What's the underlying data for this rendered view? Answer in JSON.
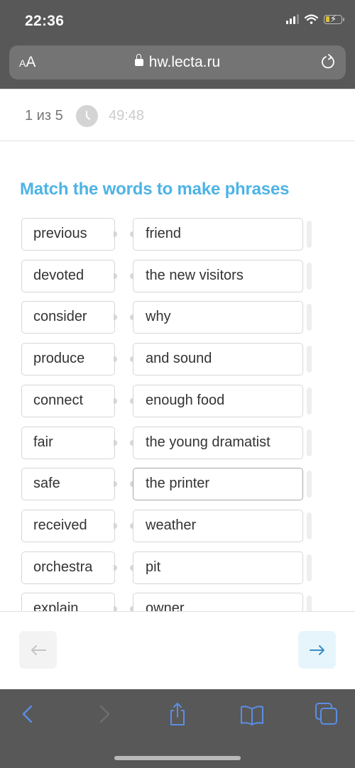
{
  "status_bar": {
    "time": "22:36",
    "icons": [
      "cellular-signal-icon",
      "wifi-icon",
      "battery-charging-icon"
    ]
  },
  "browser": {
    "text_size_label_small": "A",
    "text_size_label_large": "A",
    "url": "hw.lecta.ru",
    "icons": [
      "lock-icon",
      "reload-icon"
    ]
  },
  "quiz_header": {
    "counter": "1 из 5",
    "timer": "49:48"
  },
  "task": {
    "title": "Match the words to make phrases",
    "accent_color": "#4db3e6",
    "pairs": [
      {
        "left": "previous",
        "right": "friend",
        "selected": false
      },
      {
        "left": "devoted",
        "right": "the new visitors",
        "selected": false
      },
      {
        "left": "consider",
        "right": "why",
        "selected": false
      },
      {
        "left": "produce",
        "right": "and sound",
        "selected": false
      },
      {
        "left": "connect",
        "right": "enough food",
        "selected": false
      },
      {
        "left": "fair",
        "right": "the young dramatist",
        "selected": false
      },
      {
        "left": "safe",
        "right": "the printer",
        "selected": true
      },
      {
        "left": "received",
        "right": "weather",
        "selected": false
      },
      {
        "left": "orchestra",
        "right": "pit",
        "selected": false
      },
      {
        "left": "explain",
        "right": "owner",
        "selected": false
      }
    ]
  },
  "navigation": {
    "prev_icon": "arrow-left-icon",
    "next_icon": "arrow-right-icon",
    "prev_enabled": false,
    "next_enabled": true
  },
  "safari_toolbar": {
    "items": [
      "back-icon",
      "forward-icon",
      "share-icon",
      "bookmarks-icon",
      "tabs-icon"
    ]
  }
}
